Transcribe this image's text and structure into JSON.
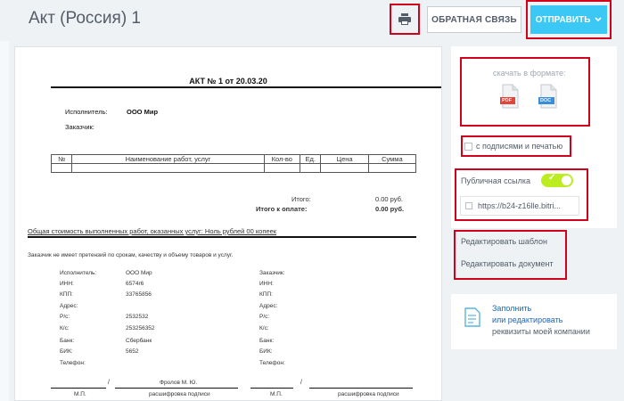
{
  "header": {
    "title": "Акт (Россия) 1",
    "feedback_label": "ОБРАТНАЯ СВЯЗЬ",
    "send_label": "ОТПРАВИТЬ"
  },
  "document": {
    "title": "АКТ № 1 от 20.03.20",
    "executor_label": "Исполнитель:",
    "executor_value": "ООО Мир",
    "customer_label": "Заказчик:",
    "table_headers": [
      "№",
      "Наименование работ, услуг",
      "Кол-во",
      "Ед.",
      "Цена",
      "Сумма"
    ],
    "total_label": "Итого:",
    "total_value": "0.00 руб.",
    "payable_label": "Итого к оплате:",
    "payable_value": "0.00 руб.",
    "total_cost_text": "Общая стоимость выполненных работ, оказанных услуг: Ноль рублей 00 копеек",
    "no_claims_text": "Заказчик не имеет претензий по срокам, качеству и объему товаров и услуг.",
    "left_req": [
      {
        "label": "Исполнитель:",
        "value": "ООО Мир"
      },
      {
        "label": "ИНН:",
        "value": "6574r6"
      },
      {
        "label": "КПП:",
        "value": "33765856"
      },
      {
        "label": "Адрес:",
        "value": ""
      },
      {
        "label": "Р/с:",
        "value": "2532532"
      },
      {
        "label": "К/с:",
        "value": "253256352"
      },
      {
        "label": "Банк:",
        "value": "Сбербанк"
      },
      {
        "label": "БИК:",
        "value": "5652"
      },
      {
        "label": "Телефон:",
        "value": ""
      }
    ],
    "right_req": [
      "Заказчик:",
      "ИНН:",
      "КПП:",
      "Адрес:",
      "Р/с:",
      "К/с:",
      "Банк:",
      "БИК:",
      "Телефон:"
    ],
    "signer_name": "Фролов М. Ю.",
    "slash": "/",
    "mp": "М.П.",
    "sign_decode": "расшифровка подписи"
  },
  "sidebar": {
    "download_label": "скачать в формате:",
    "pdf_label": "PDF",
    "doc_label": "DOC",
    "sign_stamp_label": "с подписями и печатью",
    "public_link_label": "Публичная ссылка",
    "public_link_on": true,
    "public_link_url": "https://b24-z16lle.bitri...",
    "edit_template": "Редактировать шаблон",
    "edit_document": "Редактировать документ",
    "fill_line1": "Заполнить",
    "fill_line2": "или редактировать",
    "fill_line3": "реквизиты моей компании"
  },
  "colors": {
    "accent": "#3bc8f5",
    "toggle_on": "#bbed21",
    "highlight": "#d0021b",
    "link": "#2067b0",
    "pdf_badge": "#e2453b",
    "doc_badge": "#3a8dd8"
  },
  "icons": [
    "printer-icon",
    "chevron-down-icon",
    "pdf-file-icon",
    "doc-file-icon",
    "checkbox-icon",
    "check-icon",
    "document-edit-icon"
  ]
}
